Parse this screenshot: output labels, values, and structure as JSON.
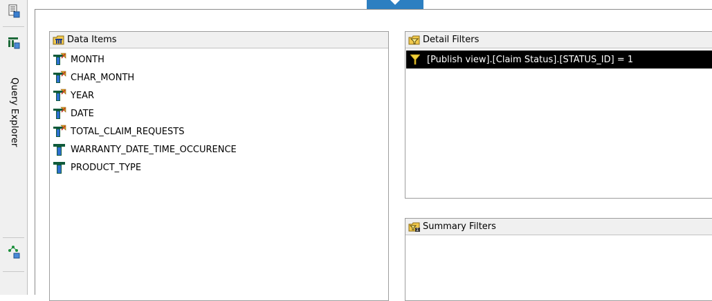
{
  "sidebar": {
    "vertical_tab_label": "Query Explorer",
    "tools": [
      {
        "icon": "report-page-icon"
      },
      {
        "icon": "query-table-icon"
      },
      {
        "icon": "hierarchy-tree-icon"
      }
    ]
  },
  "data_items": {
    "title": "Data Items",
    "items": [
      {
        "label": "MONTH",
        "icon": "calculated-data-item-icon"
      },
      {
        "label": "CHAR_MONTH",
        "icon": "calculated-data-item-icon"
      },
      {
        "label": "YEAR",
        "icon": "calculated-data-item-icon"
      },
      {
        "label": "DATE",
        "icon": "calculated-data-item-icon"
      },
      {
        "label": "TOTAL_CLAIM_REQUESTS",
        "icon": "calculated-data-item-icon"
      },
      {
        "label": "WARRANTY_DATE_TIME_OCCURENCE",
        "icon": "data-item-icon"
      },
      {
        "label": "PRODUCT_TYPE",
        "icon": "data-item-icon"
      }
    ]
  },
  "detail_filters": {
    "title": "Detail Filters",
    "filters": [
      {
        "expression": "[Publish view].[Claim Status].[STATUS_ID] = 1",
        "selected": true,
        "icon": "filter-funnel-icon"
      }
    ]
  },
  "summary_filters": {
    "title": "Summary Filters",
    "filters": []
  },
  "colors": {
    "selection_background": "#000000",
    "selection_text": "#ffffff",
    "header_background": "#f0f0f0",
    "top_tab_accent": "#2d7fc1"
  }
}
